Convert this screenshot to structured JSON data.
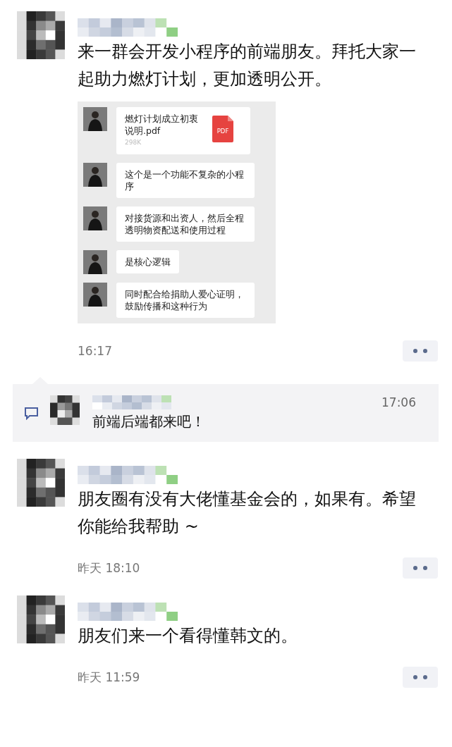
{
  "posts": [
    {
      "text": "来一群会开发小程序的前端朋友。拜托大家一起助力燃灯计划，更加透明公开。",
      "time": "16:17",
      "screenshot": {
        "messages": [
          {
            "kind": "file",
            "name": "燃灯计划成立初衷说明.pdf",
            "size": "298K",
            "badge": "PDF"
          },
          {
            "kind": "text",
            "text": "这个是一个功能不复杂的小程序"
          },
          {
            "kind": "text",
            "text": "对接货源和出资人，然后全程透明物资配送和使用过程"
          },
          {
            "kind": "text",
            "text": "是核心逻辑"
          },
          {
            "kind": "text",
            "text": "同时配合给捐助人爱心证明，鼓励传播和这种行为"
          }
        ]
      },
      "comments": [
        {
          "time": "17:06",
          "text": "前端后端都来吧！"
        }
      ]
    },
    {
      "text": "朋友圈有没有大佬懂基金会的，如果有。希望你能给我帮助 ~",
      "time": "昨天 18:10"
    },
    {
      "text": "朋友们来一个看得懂韩文的。",
      "time": "昨天 11:59"
    }
  ]
}
